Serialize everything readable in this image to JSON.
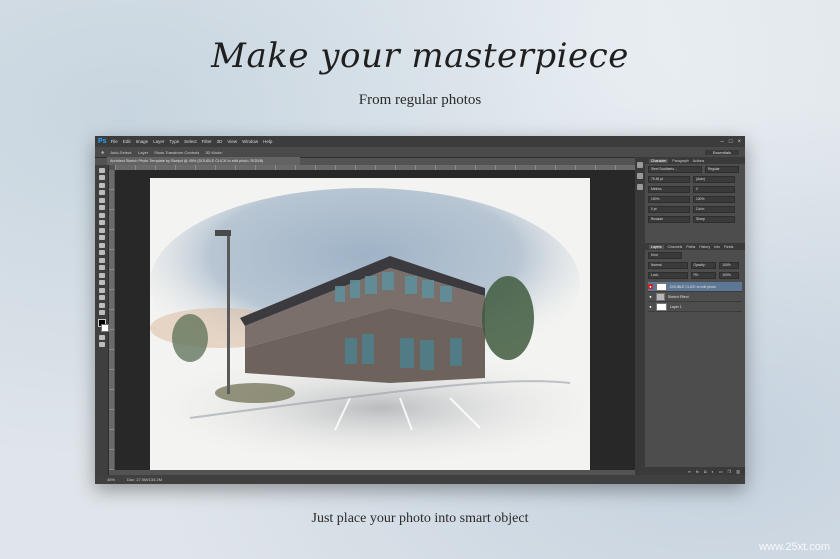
{
  "page": {
    "headline": "Make your masterpiece",
    "subheadline": "From regular photos",
    "caption": "Just place your photo into smart object",
    "watermark": "www.25xt.com"
  },
  "app": {
    "logo": "Ps",
    "menu": [
      "File",
      "Edit",
      "Image",
      "Layer",
      "Type",
      "Select",
      "Filter",
      "3D",
      "View",
      "Window",
      "Help"
    ],
    "window_controls": [
      "–",
      "□",
      "×"
    ],
    "options_bar": {
      "auto_select_label": "Auto-Select:",
      "auto_select_value": "Layer",
      "transform_label": "Show Transform Controls",
      "mode_label": "3D Mode:",
      "workspace": "Essentials"
    },
    "document_tab": "Architect Sketch Photo Template by Sketpd @ 45% (DOUBLE CLICK to edit photo, RGB/8)",
    "status": {
      "zoom": "45%",
      "doc_size": "Doc: 27.0M/134.2M"
    }
  },
  "panels": {
    "character_tabs": [
      "Character",
      "Paragraph",
      "Actions"
    ],
    "character_fields": {
      "font_family": "Steel Svoltberlo...",
      "font_style": "Regular",
      "size": "75.48 pt",
      "leading": "(Auto)",
      "kerning": "Metrics",
      "tracking": "0",
      "vscale": "100%",
      "hscale": "100%",
      "baseline": "0 pt",
      "color_label": "Color:",
      "aa": "Sharp",
      "lang": "Russian"
    },
    "layers_tabs": [
      "Layers",
      "Channels",
      "Paths",
      "History",
      "Info",
      "Fields"
    ],
    "layers_kind": "Kind",
    "layers_blend": "Normal",
    "opacity_label": "Opacity:",
    "opacity": "100%",
    "lock_label": "Lock:",
    "fill_label": "Fill:",
    "fill": "100%",
    "layers": [
      {
        "name": "DOUBLE CLICK to edit photo",
        "selected": true,
        "type": "smart"
      },
      {
        "name": "Sketch Effect",
        "selected": false,
        "type": "folder"
      },
      {
        "name": "Layer 1",
        "selected": false,
        "type": "layer"
      }
    ],
    "footer_icons": [
      "link-icon",
      "fx-icon",
      "mask-icon",
      "adjustment-icon",
      "folder-icon",
      "new-layer-icon",
      "trash-icon"
    ]
  }
}
